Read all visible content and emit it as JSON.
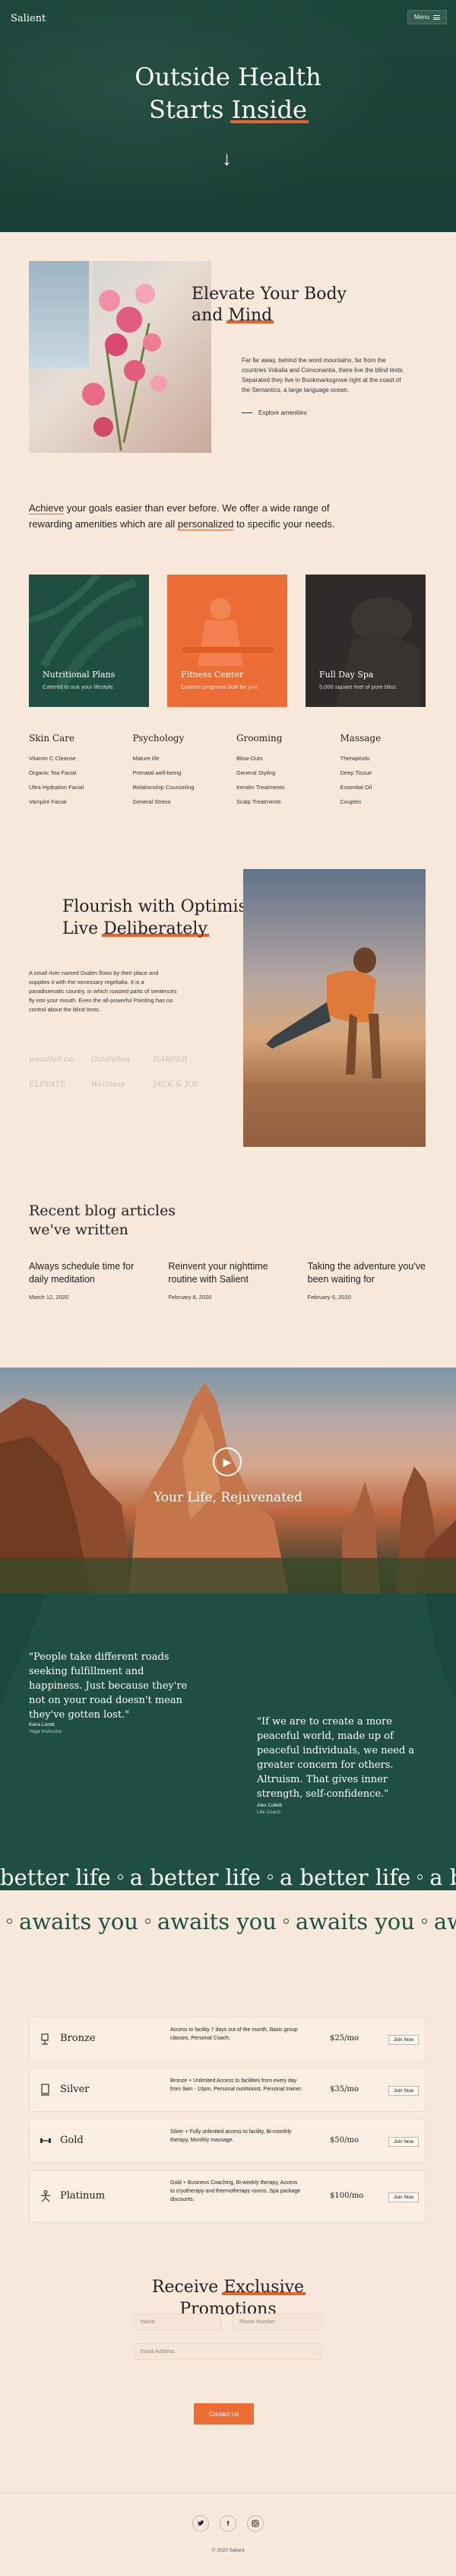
{
  "brand": "Salient",
  "nav": {
    "menu_label": "Menu"
  },
  "hero": {
    "title_line1": "Outside Health",
    "title_line2_pre": "Starts ",
    "title_line2_highlight": "Inside",
    "arrow": "↓"
  },
  "intro": {
    "heading_line1": "Elevate Your Body",
    "heading_line2_pre": "and ",
    "heading_line2_highlight": "Mind",
    "text": "Far far away, behind the word mountains, far from the countries Vokalia and Consonantia, there live the blind texts. Separated they live in Bookmarksgrove right at the coast of the Semantics, a large language ocean.",
    "link_label": "Explore amenities"
  },
  "achieve": {
    "part1": "Achieve",
    "part2": " your goals easier than ever before. We offer a wide range of rewarding amenities which are all ",
    "part3": "personalized",
    "part4": " to specific your needs."
  },
  "cards": [
    {
      "title": "Nutritional Plans",
      "sub": "Catered to suit your lifestyle."
    },
    {
      "title": "Fitness Center",
      "sub": "Custom programs built for you."
    },
    {
      "title": "Full Day Spa",
      "sub": "5,000 square feet of pure bliss."
    }
  ],
  "categories": [
    {
      "title": "Skin Care",
      "items": [
        "Vitamin C Cleanse",
        "Organic Tea Facial",
        "Ultra Hydration Facial",
        "Vampire Facial"
      ]
    },
    {
      "title": "Psychology",
      "items": [
        "Mature life",
        "Prenatal well-being",
        "Relationship Counseling",
        "General Stress"
      ]
    },
    {
      "title": "Grooming",
      "items": [
        "Blow-Outs",
        "General Styling",
        "Keratin Treatments",
        "Scalp Treatments"
      ]
    },
    {
      "title": "Massage",
      "items": [
        "Therapeutic",
        "Deep Tissue",
        "Essential Oil",
        "Couples"
      ]
    }
  ],
  "flourish": {
    "heading_line1": "Flourish with Optimism,",
    "heading_line2_pre": "Live ",
    "heading_line2_highlight": "Deliberately",
    "text": "A small river named Duden flows by their place and supplies it with the necessary regelialia. It is a paradisematic country, in which roasted parts of sentences fly into your mouth. Even the all-powerful Pointing has no control about the blind texts.",
    "brands": [
      "woodfall co.",
      "Dandelion",
      "HARPER",
      "ELEVATE",
      "Wellness",
      "JACK & JOE"
    ]
  },
  "blog": {
    "heading_line1": "Recent blog articles",
    "heading_line2": "we've written",
    "posts": [
      {
        "title": "Always schedule time for daily meditation",
        "date": "March 12, 2020"
      },
      {
        "title": "Reinvent your nighttime routine with Salient",
        "date": "February 8, 2020"
      },
      {
        "title": "Taking the adventure you've been waiting for",
        "date": "February 6, 2020"
      }
    ]
  },
  "video": {
    "title": "Your Life, Rejuvenated"
  },
  "quotes": [
    {
      "text": "\"People take different roads seeking fulfillment and happiness. Just because they're not on your road doesn't mean they've gotten lost.\"",
      "name": "Keira Lorett",
      "role": "Yoga Instructor"
    },
    {
      "text": "\"If we are to create a more peaceful world, made up of peaceful individuals, we need a greater concern for others. Altruism. That gives inner strength, self-confidence.\"",
      "name": "Alex Collett",
      "role": "Life Coach"
    }
  ],
  "marquee": {
    "line1": "better life",
    "line1_prefix": "a",
    "line2": "awaits you"
  },
  "plans": [
    {
      "name": "Bronze",
      "desc": "Access to facility 7 days out of the month, Basic group classes, Personal Coach.",
      "price": "$25/mo",
      "button": "Join Now"
    },
    {
      "name": "Silver",
      "desc": "Bronze + Unlimited Access to facilities from every day from 9am - 10pm, Personal nutritionist, Personal trainer.",
      "price": "$35/mo",
      "button": "Join Now"
    },
    {
      "name": "Gold",
      "desc": "Silver + Fully unlimited access to facility, Bi-monthly therapy, Monthly massage.",
      "price": "$50/mo",
      "button": "Join Now"
    },
    {
      "name": "Platinum",
      "desc": "Gold + Business Coaching, Bi-weekly therapy, Access to cryotherapy and thermotherapy rooms, Spa package discounts.",
      "price": "$100/mo",
      "button": "Join Now"
    }
  ],
  "promo": {
    "heading_line1_pre": "Receive ",
    "heading_line1_highlight": "Exclusive",
    "heading_line2": "Promotions",
    "name_placeholder": "Name",
    "phone_placeholder": "Phone Number",
    "email_placeholder": "Email Address",
    "button": "Contact Us"
  },
  "footer": {
    "copyright": "© 2020 Salient",
    "socials": [
      "twitter-icon",
      "facebook-icon",
      "instagram-icon"
    ]
  },
  "colors": {
    "accent": "#ec6e36",
    "green": "#1f4f41",
    "cream": "#f9e9dc",
    "dark": "#2e2b28"
  }
}
